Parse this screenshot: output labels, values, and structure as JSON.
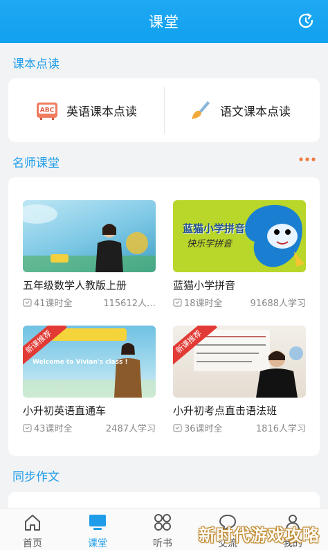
{
  "header": {
    "title": "课堂"
  },
  "sections": {
    "reading": "课本点读",
    "teachers": "名师课堂",
    "sync": "同步作文"
  },
  "reading_items": [
    {
      "label": "英语课本点读",
      "icon": "abc-book-icon"
    },
    {
      "label": "语文课本点读",
      "icon": "brush-icon"
    }
  ],
  "courses": [
    {
      "title": "五年级数学人教版上册",
      "lessons": "41课时全",
      "learners": "115612人…",
      "badge": ""
    },
    {
      "title": "蓝猫小学拼音",
      "lessons": "18课时全",
      "learners": "91688人学习",
      "badge": "",
      "thumb_text": "蓝猫小学拼音",
      "thumb_sub": "快乐学拼音"
    },
    {
      "title": "小升初英语直通车",
      "lessons": "43课时全",
      "learners": "2487人学习",
      "badge": "新课推荐",
      "thumb_text": "Welcome to Vivian's class !"
    },
    {
      "title": "小升初考点直击语法班",
      "lessons": "36课时全",
      "learners": "1816人学习",
      "badge": "新课推荐"
    }
  ],
  "tabs": [
    {
      "label": "首页",
      "icon": "home-icon",
      "active": false
    },
    {
      "label": "课堂",
      "icon": "monitor-icon",
      "active": true
    },
    {
      "label": "听书",
      "icon": "grid-icon",
      "active": false
    },
    {
      "label": "交流",
      "icon": "chat-icon",
      "active": false
    },
    {
      "label": "我的",
      "icon": "profile-icon",
      "active": false
    }
  ],
  "watermark": "新时代游戏攻略",
  "colors": {
    "accent": "#1f9de8",
    "header": "#14a3f0",
    "badge": "#e23b35",
    "more_dots": "#f07b3f"
  }
}
